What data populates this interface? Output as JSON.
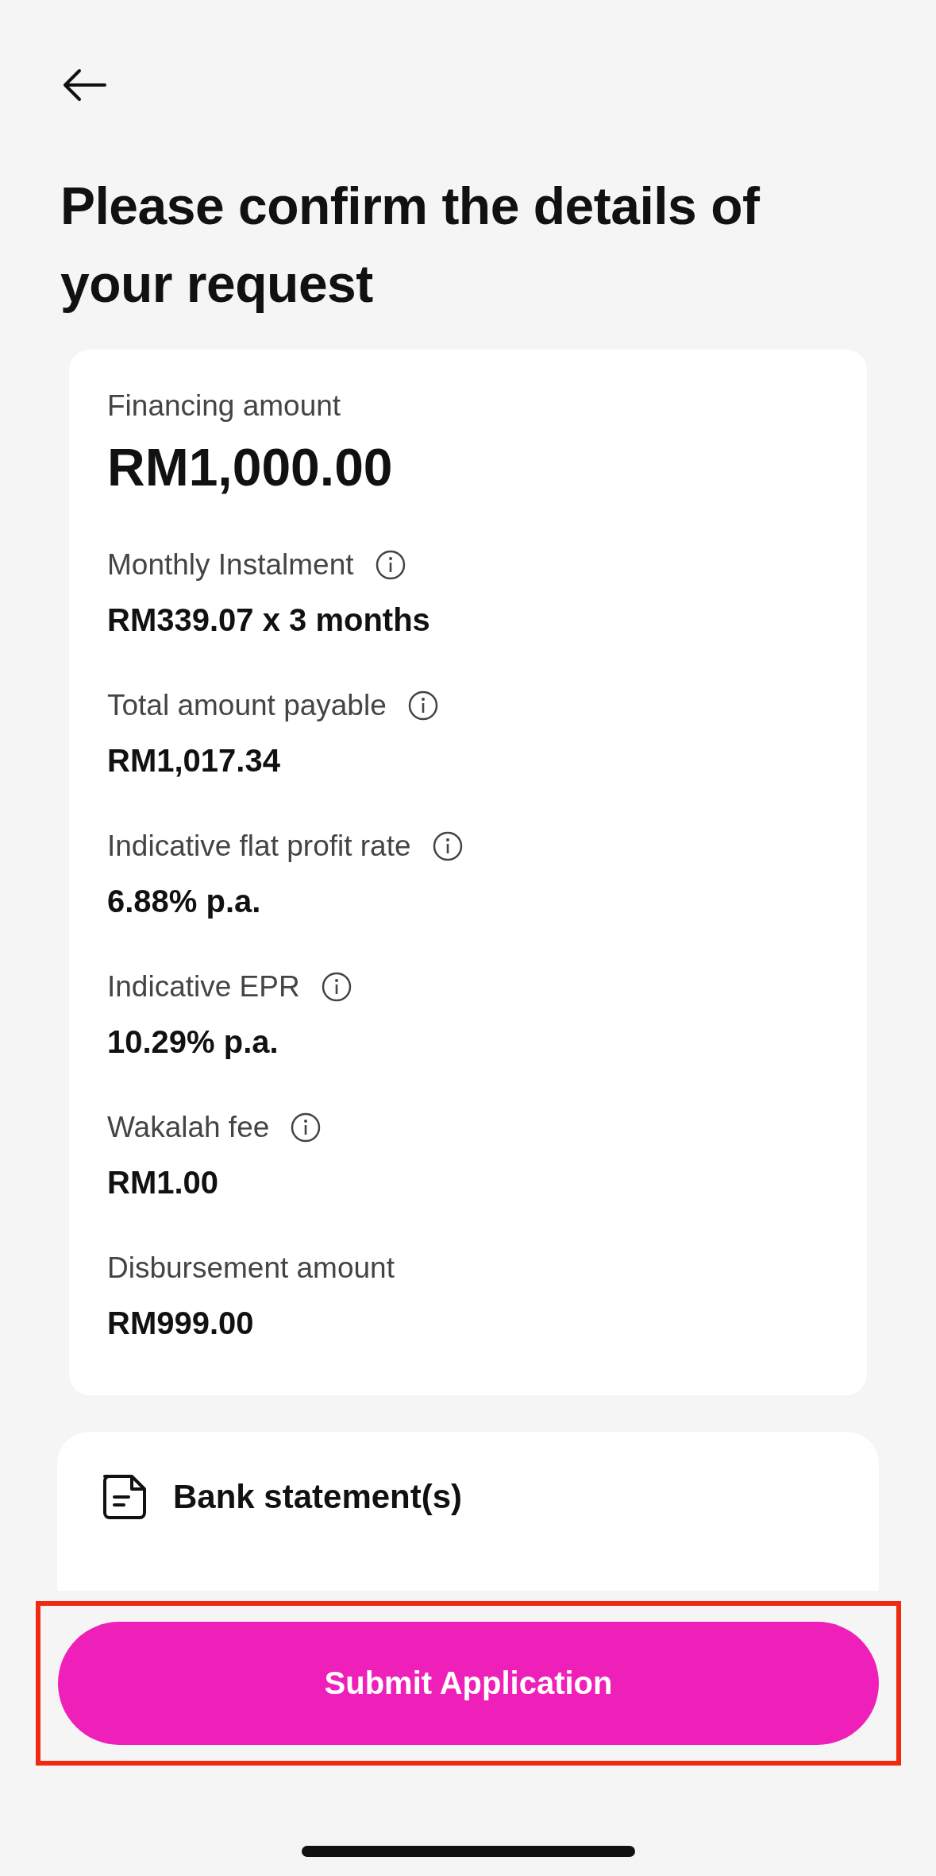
{
  "title": "Please confirm the details of your request",
  "summary": {
    "amount_label": "Financing amount",
    "amount": "RM1,000.00",
    "items": [
      {
        "label": "Monthly Instalment",
        "value": "RM339.07 x 3 months",
        "info": true
      },
      {
        "label": "Total amount payable",
        "value": "RM1,017.34",
        "info": true
      },
      {
        "label": "Indicative flat profit rate",
        "value": "6.88% p.a.",
        "info": true
      },
      {
        "label": "Indicative EPR",
        "value": "10.29% p.a.",
        "info": true
      },
      {
        "label": "Wakalah fee",
        "value": "RM1.00",
        "info": true
      },
      {
        "label": "Disbursement amount",
        "value": "RM999.00",
        "info": false
      }
    ]
  },
  "documents": {
    "title": "Bank statement(s)"
  },
  "submit_button": {
    "label": "Submit Application",
    "highlighted": true
  }
}
